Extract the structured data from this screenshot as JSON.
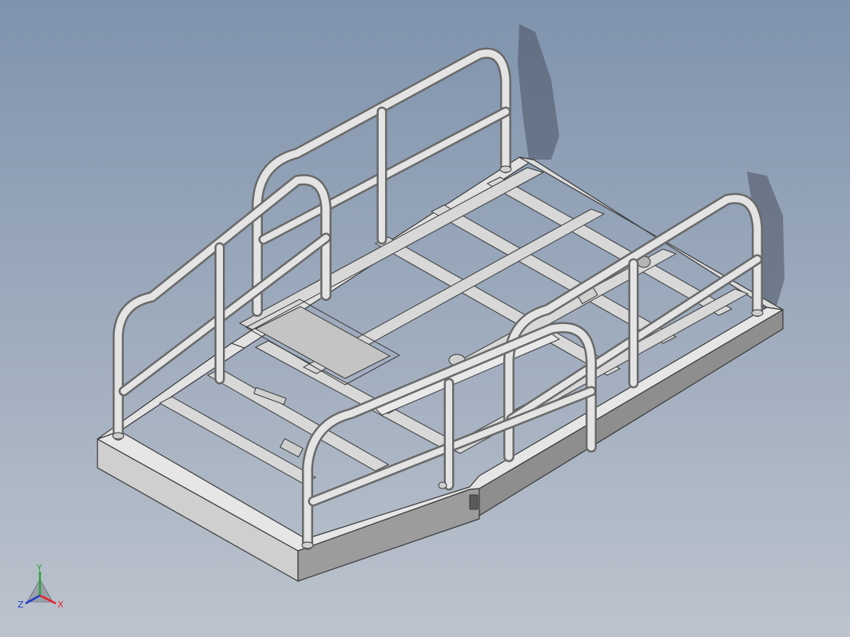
{
  "viewport": {
    "background_top": "#7f93ad",
    "background_bottom": "#bcc3cd"
  },
  "model": {
    "colors": {
      "metal_light": "#eaeaea",
      "metal_mid": "#bdbdbd",
      "metal_dark": "#7a7a7a",
      "edge": "#3a3a3a",
      "shadow": "#4a5262"
    },
    "icon": "isometric-platform-cart-model"
  },
  "triad": {
    "x_label": "X",
    "y_label": "Y",
    "z_label": "Z",
    "x_color": "#e0252b",
    "y_color": "#2fa23a",
    "z_color": "#2440c8"
  }
}
